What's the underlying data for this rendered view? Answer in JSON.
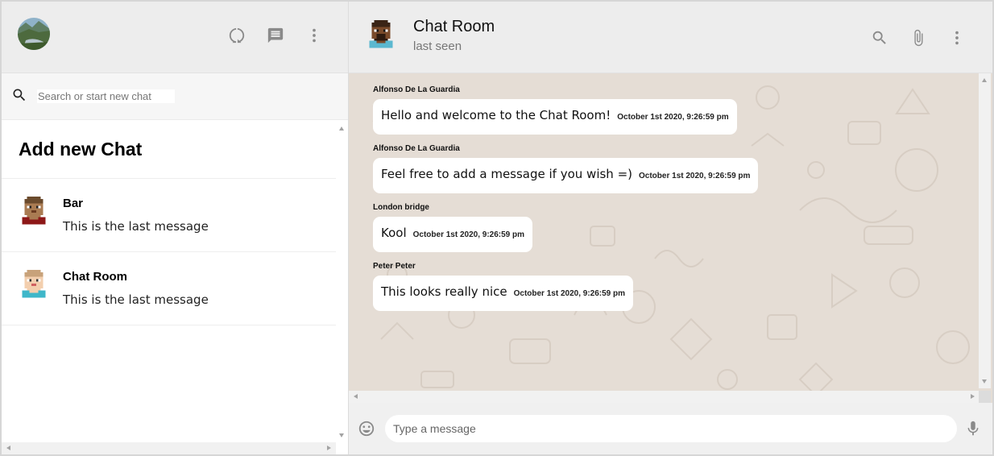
{
  "sidebar": {
    "icons": [
      "avatar",
      "status-icon",
      "new-chat-icon",
      "more-vert-icon"
    ],
    "search": {
      "placeholder": "Search or start new chat",
      "value": ""
    },
    "add_chat_label": "Add new Chat",
    "chats": [
      {
        "name": "Bar",
        "last_message": "This is the last message",
        "avatar_icon": "pixel-avatar-dark"
      },
      {
        "name": "Chat Room",
        "last_message": "This is the last message",
        "avatar_icon": "pixel-avatar-light"
      }
    ]
  },
  "header": {
    "title": "Chat Room",
    "status": "last seen",
    "icons": [
      "search-icon",
      "attach-icon",
      "more-vert-icon"
    ]
  },
  "messages": [
    {
      "author": "Alfonso De La Guardia",
      "text": "Hello and welcome to the Chat Room!",
      "time": "October 1st 2020, 9:26:59 pm"
    },
    {
      "author": "Alfonso De La Guardia",
      "text": "Feel free to add a message if you wish =)",
      "time": "October 1st 2020, 9:26:59 pm"
    },
    {
      "author": "London bridge",
      "text": "Kool",
      "time": "October 1st 2020, 9:26:59 pm"
    },
    {
      "author": "Peter Peter",
      "text": "This looks really nice",
      "time": "October 1st 2020, 9:26:59 pm"
    }
  ],
  "footer": {
    "input_placeholder": "Type a message",
    "input_value": "",
    "icons": [
      "emoji-icon",
      "mic-icon"
    ]
  },
  "colors": {
    "header_bg": "#ededed",
    "chat_bg": "#e5ddd5",
    "bubble_bg": "#ffffff",
    "icon_gray": "#8a8a8a"
  }
}
